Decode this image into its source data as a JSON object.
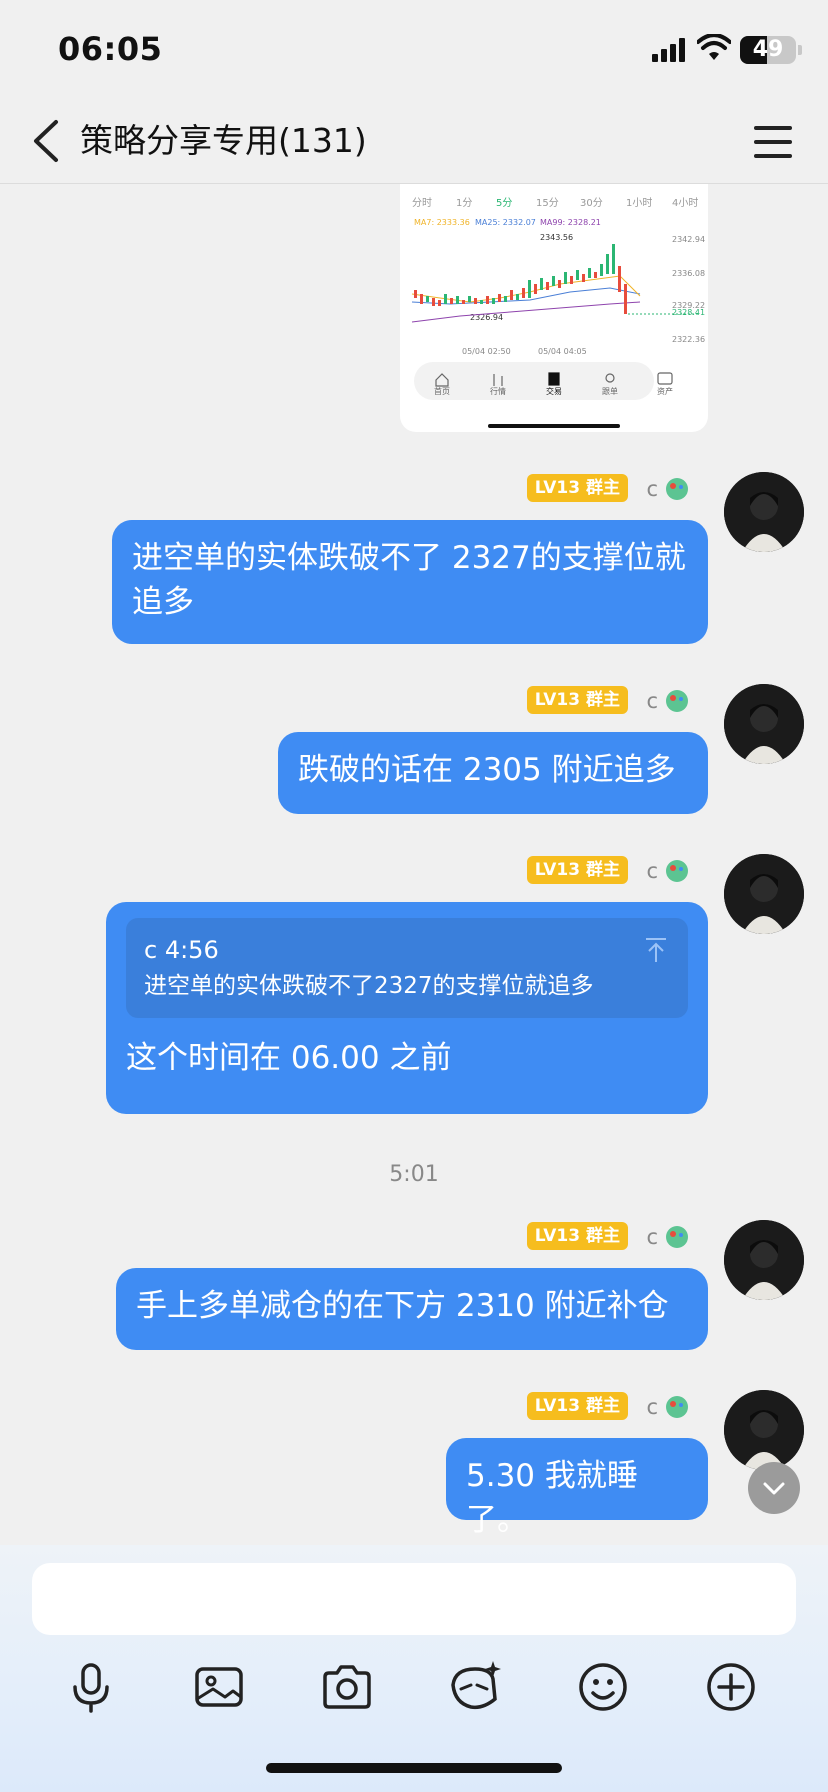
{
  "status_bar": {
    "time": "06:05",
    "battery": "49",
    "battery_level": 0.49
  },
  "header": {
    "title": "策略分享专用(131)"
  },
  "shared_chart": {
    "timeframe_tabs": [
      "分时",
      "1分",
      "5分",
      "15分",
      "30分",
      "1小时",
      "4小时"
    ],
    "active_tab_index": 2,
    "ma_legend": {
      "ma7": "MA7: 2333.36",
      "ma25": "MA25: 2332.07",
      "ma99": "MA99: 2328.21"
    },
    "price_labels": [
      "2342.94",
      "2336.08",
      "2329.22",
      "2328.41",
      "2322.36"
    ],
    "high_label": "2343.56",
    "low_label": "2326.94",
    "date_labels": [
      "05/04 02:50",
      "05/04 04:05"
    ],
    "app_tabs": [
      "首页",
      "行情",
      "交易",
      "跟单",
      "资产"
    ],
    "active_app_tab": 2
  },
  "messages": [
    {
      "badge": "LV13 群主",
      "sender": "c",
      "text": "进空单的实体跌破不了 2327的支撑位就追多"
    },
    {
      "badge": "LV13 群主",
      "sender": "c",
      "text": "跌破的话在 2305 附近追多"
    },
    {
      "badge": "LV13 群主",
      "sender": "c",
      "reply_author": "c 4:56",
      "reply_text": "进空单的实体跌破不了2327的支撑位就追多",
      "text": "这个时间在 06.00 之前"
    },
    {
      "badge": "LV13 群主",
      "sender": "c",
      "text": "手上多单减仓的在下方 2310 附近补仓"
    },
    {
      "badge": "LV13 群主",
      "sender": "c",
      "text": "5.30 我就睡了。"
    }
  ],
  "time_divider": "5:01",
  "input": {
    "placeholder": ""
  },
  "toolbar": {
    "icons": [
      "microphone-icon",
      "image-icon",
      "camera-icon",
      "sticker-icon",
      "emoji-icon",
      "plus-icon"
    ]
  },
  "colors": {
    "bubble": "#3f8cf3",
    "badge": "#f6bd1e",
    "background": "#f0f0f0"
  }
}
